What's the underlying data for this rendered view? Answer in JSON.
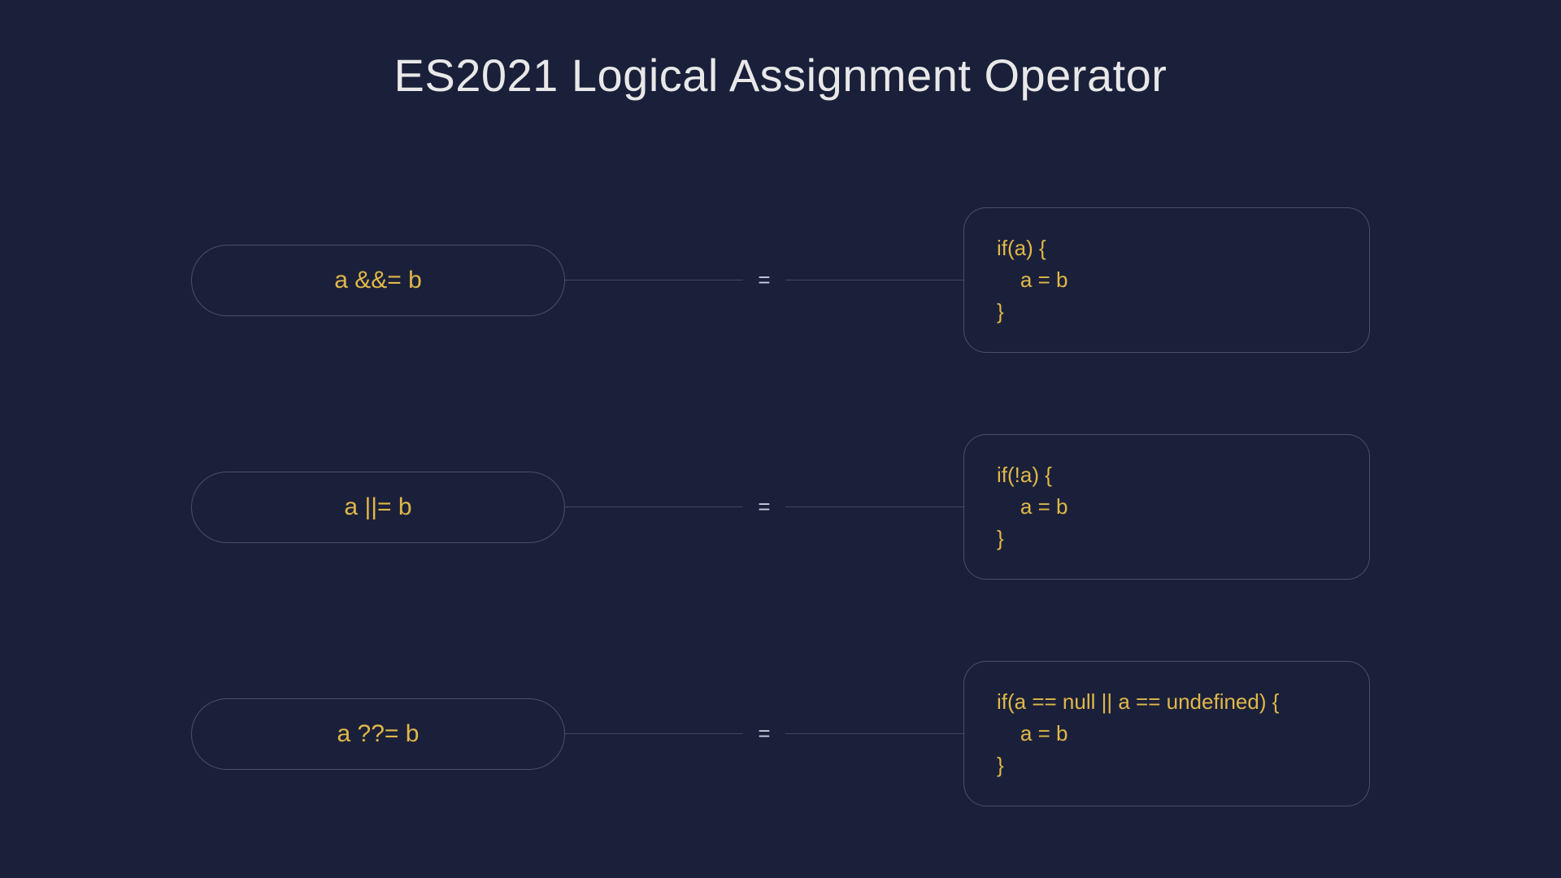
{
  "title": "ES2021 Logical Assignment Operator",
  "rows": [
    {
      "operator": "a &&= b",
      "equals": "=",
      "code": "if(a) {\n    a = b\n}"
    },
    {
      "operator": "a ||= b",
      "equals": "=",
      "code": "if(!a) {\n    a = b\n}"
    },
    {
      "operator": "a ??= b",
      "equals": "=",
      "code": "if(a == null || a == undefined) {\n    a = b\n}"
    }
  ]
}
